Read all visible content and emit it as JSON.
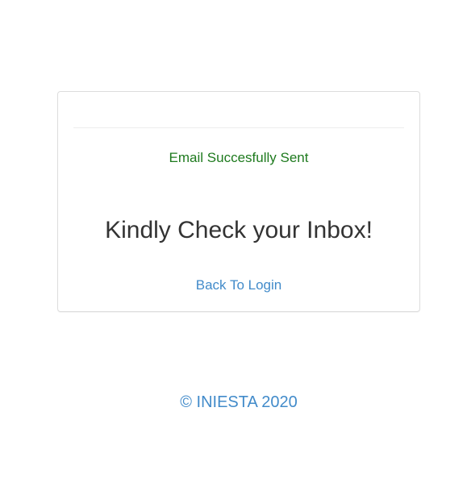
{
  "card": {
    "status_message": "Email Succesfully Sent",
    "headline": "Kindly Check your Inbox!",
    "back_link_label": "Back To Login"
  },
  "footer": {
    "copyright": "© INIESTA 2020"
  },
  "colors": {
    "success": "#1e7a1e",
    "link": "#428bca",
    "text": "#333333",
    "border": "#dddddd"
  }
}
